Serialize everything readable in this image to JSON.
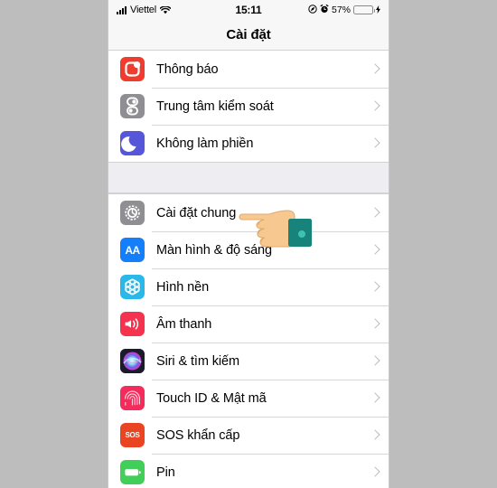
{
  "status_bar": {
    "carrier": "Viettel",
    "signal_icon": "cellular-bars-icon",
    "wifi_icon": "wifi-icon",
    "time": "15:11",
    "location_icon": "location-services-icon",
    "alarm_icon": "alarm-clock-icon",
    "battery_percent": "57%",
    "battery_fill": 57,
    "battery_color": "#f2c014",
    "charging_icon": "lightning-bolt-icon"
  },
  "nav": {
    "title": "Cài đặt"
  },
  "groups": [
    {
      "id": "group-notifications",
      "rows": [
        {
          "label": "Thông báo",
          "icon": "notifications-icon",
          "icon_class": "ic-notify",
          "color": "#f03b2f"
        },
        {
          "label": "Trung tâm kiểm soát",
          "icon": "control-center-icon",
          "icon_class": "ic-control",
          "color": "#8e8e93"
        },
        {
          "label": "Không làm phiền",
          "icon": "do-not-disturb-icon",
          "icon_class": "ic-dnd",
          "color": "#5557d8"
        }
      ]
    },
    {
      "id": "group-general",
      "rows": [
        {
          "label": "Cài đặt chung",
          "icon": "general-gear-icon",
          "icon_class": "ic-general",
          "color": "#8e8e93"
        },
        {
          "label": "Màn hình & độ sáng",
          "icon": "display-brightness-icon",
          "icon_class": "ic-display",
          "color": "#147efb",
          "glyph": "AA"
        },
        {
          "label": "Hình nền",
          "icon": "wallpaper-icon",
          "icon_class": "ic-wallpaper",
          "color": "#2ab8e8"
        },
        {
          "label": "Âm thanh",
          "icon": "sound-speaker-icon",
          "icon_class": "ic-sound",
          "color": "#f5334f"
        },
        {
          "label": "Siri & tìm kiếm",
          "icon": "siri-icon",
          "icon_class": "ic-siri",
          "color": "#1b1b2b"
        },
        {
          "label": "Touch ID & Mật mã",
          "icon": "touch-id-fingerprint-icon",
          "icon_class": "ic-touchid",
          "color": "#f42b5b"
        },
        {
          "label": "SOS khẩn cấp",
          "icon": "sos-icon",
          "icon_class": "ic-sos",
          "color": "#ea4522",
          "glyph": "SOS"
        },
        {
          "label": "Pin",
          "icon": "battery-icon",
          "icon_class": "ic-battery",
          "color": "#41cf5a"
        }
      ]
    }
  ],
  "cursor": {
    "icon": "pointing-hand-cursor",
    "skin_color": "#f7c88f",
    "cuff_color": "#18837a",
    "target_row": "Cài đặt chung"
  }
}
